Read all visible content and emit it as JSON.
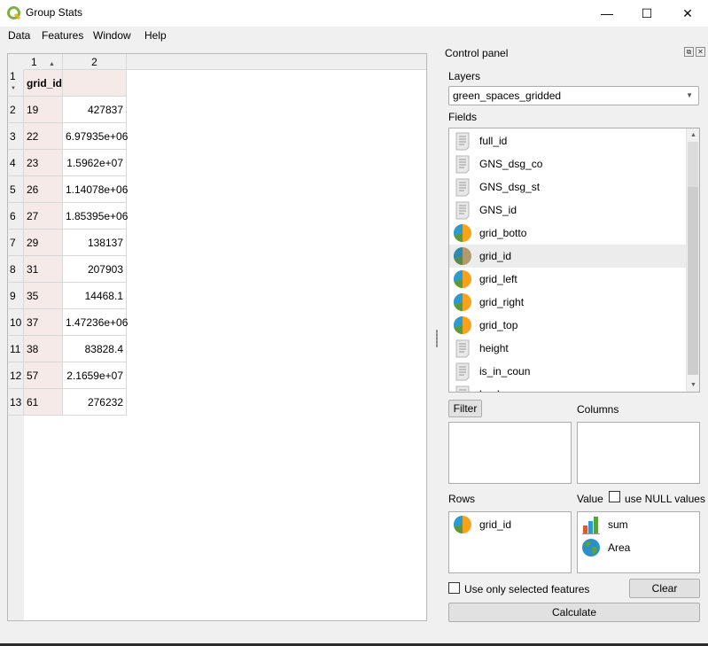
{
  "window": {
    "title": "Group Stats",
    "controls": {
      "minimize": "—",
      "maximize": "☐",
      "close": "✕"
    }
  },
  "menubar": {
    "items": [
      {
        "label": "Data",
        "mnemonic": "D"
      },
      {
        "label": "Features",
        "mnemonic": "u"
      },
      {
        "label": "Window",
        "mnemonic": "i"
      },
      {
        "label": "Help",
        "mnemonic": "l"
      }
    ]
  },
  "table": {
    "column_headers": [
      "1",
      "2"
    ],
    "sort_indicator": "▲",
    "header_row": {
      "row_label": "1",
      "col1": "grid_id",
      "col2": ""
    },
    "rows": [
      {
        "row": "2",
        "grid_id": "19",
        "value": "427837"
      },
      {
        "row": "3",
        "grid_id": "22",
        "value": "6.97935e+06"
      },
      {
        "row": "4",
        "grid_id": "23",
        "value": "1.5962e+07"
      },
      {
        "row": "5",
        "grid_id": "26",
        "value": "1.14078e+06"
      },
      {
        "row": "6",
        "grid_id": "27",
        "value": "1.85395e+06"
      },
      {
        "row": "7",
        "grid_id": "29",
        "value": "138137"
      },
      {
        "row": "8",
        "grid_id": "31",
        "value": "207903"
      },
      {
        "row": "9",
        "grid_id": "35",
        "value": "14468.1"
      },
      {
        "row": "10",
        "grid_id": "37",
        "value": "1.47236e+06"
      },
      {
        "row": "11",
        "grid_id": "38",
        "value": "83828.4"
      },
      {
        "row": "12",
        "grid_id": "57",
        "value": "2.1659e+07"
      },
      {
        "row": "13",
        "grid_id": "61",
        "value": "276232"
      }
    ]
  },
  "control_panel": {
    "title": "Control panel",
    "layers_label": "Layers",
    "layer_selected": "green_spaces_gridded",
    "fields_label": "Fields",
    "fields": [
      {
        "name": "full_id",
        "type": "text"
      },
      {
        "name": "GNS_dsg_co",
        "type": "text"
      },
      {
        "name": "GNS_dsg_st",
        "type": "text"
      },
      {
        "name": "GNS_id",
        "type": "text"
      },
      {
        "name": "grid_botto",
        "type": "numeric"
      },
      {
        "name": "grid_id",
        "type": "numeric",
        "selected": true
      },
      {
        "name": "grid_left",
        "type": "numeric"
      },
      {
        "name": "grid_right",
        "type": "numeric"
      },
      {
        "name": "grid_top",
        "type": "numeric"
      },
      {
        "name": "height",
        "type": "text"
      },
      {
        "name": "is_in_coun",
        "type": "text"
      },
      {
        "name": "land",
        "type": "text"
      }
    ],
    "filter_button": "Filter",
    "columns_label": "Columns",
    "rows_label": "Rows",
    "value_label": "Value",
    "use_null_label": "use NULL values",
    "use_null_checked": false,
    "rows_items": [
      {
        "name": "grid_id",
        "type": "numeric"
      }
    ],
    "value_items": [
      {
        "name": "sum",
        "type": "statistic"
      },
      {
        "name": "Area",
        "type": "geometry"
      }
    ],
    "selected_only_label": "Use only selected features",
    "selected_only_checked": false,
    "clear_button": "Clear",
    "calculate_button": "Calculate"
  },
  "colors": {
    "grid_id_column_bg": "#f6eae8",
    "header_bg": "#efefef",
    "selection_bg": "#ececec"
  }
}
